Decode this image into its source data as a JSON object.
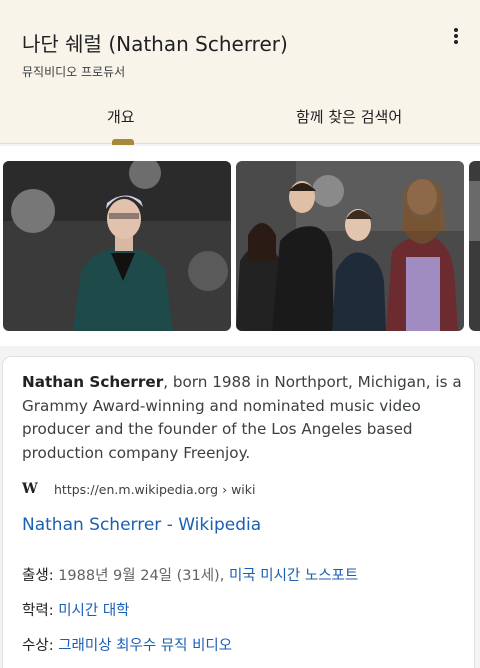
{
  "header": {
    "title": "나단 쉐럴 (Nathan Scherrer)",
    "subtitle": "뮤직비디오 프로듀서",
    "tabs": [
      {
        "label": "개요",
        "active": true
      },
      {
        "label": "함께 찾은 검색어",
        "active": false
      }
    ],
    "accent_color": "#a8883a"
  },
  "images": [
    {
      "name": "photo-nathan-scherrer"
    },
    {
      "name": "photo-group"
    },
    {
      "name": "photo-partial"
    }
  ],
  "card": {
    "name_bold": "Nathan Scherrer",
    "description_rest": ", born 1988 in Northport, Michigan, is a Grammy Award-winning and nominated music video producer and the founder of the Los Angeles based production company Freenjoy.",
    "source_icon": "W",
    "source_url": "https://en.m.wikipedia.org › wiki",
    "link_title": "Nathan Scherrer - Wikipedia",
    "facts": [
      {
        "label": "출생",
        "value": "1988년 9월 24일 (31세), ",
        "link": "미국 미시간 노스포트"
      },
      {
        "label": "학력",
        "value": "",
        "link": "미시간 대학"
      },
      {
        "label": "수상",
        "value": "",
        "link": "그래미상 최우수 뮤직 비디오"
      }
    ],
    "link_color": "#1a5fb4"
  }
}
